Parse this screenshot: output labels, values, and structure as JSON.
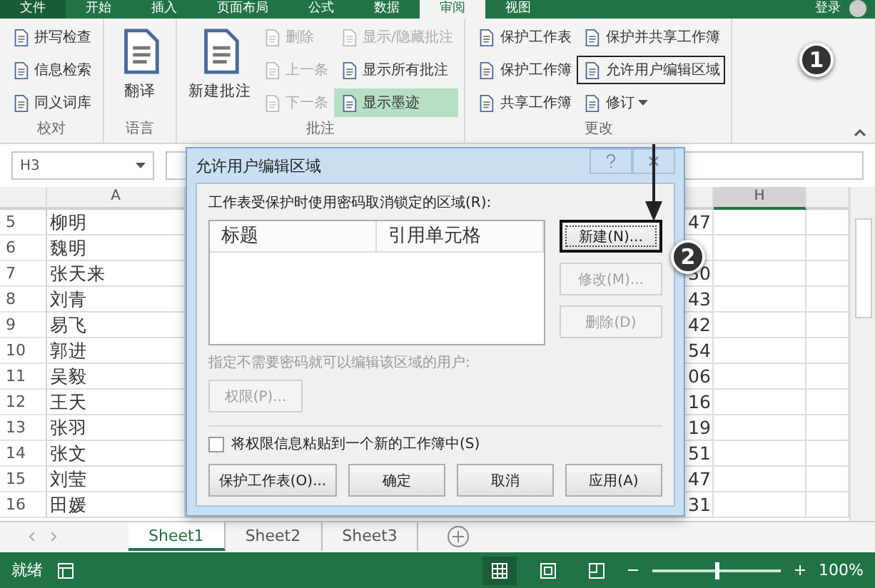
{
  "ribbon_tabs": [
    {
      "label": "文件",
      "kind": "file",
      "selected": false
    },
    {
      "label": "开始",
      "kind": "tab",
      "selected": false
    },
    {
      "label": "插入",
      "kind": "tab",
      "selected": false
    },
    {
      "label": "页面布局",
      "kind": "tab",
      "selected": false
    },
    {
      "label": "公式",
      "kind": "tab",
      "selected": false
    },
    {
      "label": "数据",
      "kind": "tab",
      "selected": false
    },
    {
      "label": "审阅",
      "kind": "tab",
      "selected": true
    },
    {
      "label": "视图",
      "kind": "tab",
      "selected": false
    }
  ],
  "account": {
    "label": "登录"
  },
  "ribbon_groups": [
    {
      "label": "校对",
      "columns": [
        [
          {
            "label": "拼写检查",
            "kind": "small",
            "disabled": false,
            "on": false,
            "outlined": false
          },
          {
            "label": "信息检索",
            "kind": "small",
            "disabled": false,
            "on": false,
            "outlined": false
          },
          {
            "label": "同义词库",
            "kind": "small",
            "disabled": false,
            "on": false,
            "outlined": false
          }
        ]
      ]
    },
    {
      "label": "语言",
      "columns": [
        [
          {
            "label": "翻译",
            "kind": "large",
            "disabled": false,
            "on": false,
            "outlined": false
          }
        ]
      ]
    },
    {
      "label": "批注",
      "columns": [
        [
          {
            "label": "新建批注",
            "kind": "large",
            "disabled": false,
            "on": false,
            "outlined": false
          }
        ],
        [
          {
            "label": "删除",
            "kind": "small",
            "disabled": true,
            "on": false,
            "outlined": false
          },
          {
            "label": "上一条",
            "kind": "small",
            "disabled": true,
            "on": false,
            "outlined": false
          },
          {
            "label": "下一条",
            "kind": "small",
            "disabled": true,
            "on": false,
            "outlined": false
          }
        ],
        [
          {
            "label": "显示/隐藏批注",
            "kind": "small",
            "disabled": true,
            "on": false,
            "outlined": false
          },
          {
            "label": "显示所有批注",
            "kind": "small",
            "disabled": false,
            "on": false,
            "outlined": false
          },
          {
            "label": "显示墨迹",
            "kind": "small",
            "disabled": false,
            "on": true,
            "outlined": false
          }
        ]
      ]
    },
    {
      "label": "更改",
      "columns": [
        [
          {
            "label": "保护工作表",
            "kind": "small",
            "disabled": false,
            "on": false,
            "outlined": false
          },
          {
            "label": "保护工作簿",
            "kind": "small",
            "disabled": false,
            "on": false,
            "outlined": false
          },
          {
            "label": "共享工作簿",
            "kind": "small",
            "disabled": false,
            "on": false,
            "outlined": false
          }
        ],
        [
          {
            "label": "保护并共享工作簿",
            "kind": "small",
            "disabled": false,
            "on": false,
            "outlined": false
          },
          {
            "label": "允许用户编辑区域",
            "kind": "small",
            "disabled": false,
            "on": false,
            "outlined": true
          },
          {
            "label": "修订",
            "kind": "dropdown",
            "disabled": false,
            "on": false,
            "outlined": false
          }
        ]
      ]
    }
  ],
  "name_box": "H3",
  "sheet": {
    "columns": [
      {
        "label": "A",
        "selected": false
      },
      {
        "label": "H",
        "selected": true
      }
    ],
    "rows": [
      {
        "number": "5",
        "name": "柳明",
        "value": "47"
      },
      {
        "number": "6",
        "name": "魏明"
      },
      {
        "number": "7",
        "name": "张天来",
        "value": "30"
      },
      {
        "number": "8",
        "name": "刘青",
        "value": "43"
      },
      {
        "number": "9",
        "name": "易飞",
        "value": "42"
      },
      {
        "number": "10",
        "name": "郭进",
        "value": "54"
      },
      {
        "number": "11",
        "name": "吴毅",
        "value": "06"
      },
      {
        "number": "12",
        "name": "王天",
        "value": "16"
      },
      {
        "number": "13",
        "name": "张羽",
        "value": "19"
      },
      {
        "number": "14",
        "name": "张文",
        "value": "51"
      },
      {
        "number": "15",
        "name": "刘莹",
        "value": "47"
      },
      {
        "number": "16",
        "name": "田媛",
        "value": "31"
      }
    ]
  },
  "sheet_tabs": [
    {
      "label": "Sheet1",
      "selected": true
    },
    {
      "label": "Sheet2",
      "selected": false
    },
    {
      "label": "Sheet3",
      "selected": false
    }
  ],
  "status_bar": {
    "label": "就绪",
    "views": [
      {
        "kind": "normal",
        "selected": true
      },
      {
        "kind": "layout",
        "selected": false
      },
      {
        "kind": "pagebreak",
        "selected": false
      }
    ],
    "zoom": {
      "level": 0.5,
      "reading": "100%"
    }
  },
  "dialog": {
    "title": "允许用户编辑区域",
    "ranges_label": "工作表受保护时使用密码取消锁定的区域(R):",
    "list_columns": [
      "标题",
      "引用单元格"
    ],
    "side_buttons": [
      {
        "label": "新建(N)...",
        "disabled": false,
        "focused": true
      },
      {
        "label": "修改(M)...",
        "disabled": true,
        "focused": false
      },
      {
        "label": "删除(D)",
        "disabled": true,
        "focused": false
      }
    ],
    "users_label": "指定不需要密码就可以编辑该区域的用户:",
    "permissions_button": {
      "label": "权限(P)...",
      "disabled": true
    },
    "paste_option": {
      "label": "将权限信息粘贴到一个新的工作簿中(S)",
      "checked": false
    },
    "bottom_buttons": [
      {
        "label": "保护工作表(O)...",
        "disabled": false
      },
      {
        "label": "确定",
        "disabled": false
      },
      {
        "label": "取消",
        "disabled": false
      },
      {
        "label": "应用(A)",
        "disabled": false
      }
    ]
  },
  "callouts": [
    {
      "label": "1"
    },
    {
      "label": "2"
    }
  ]
}
